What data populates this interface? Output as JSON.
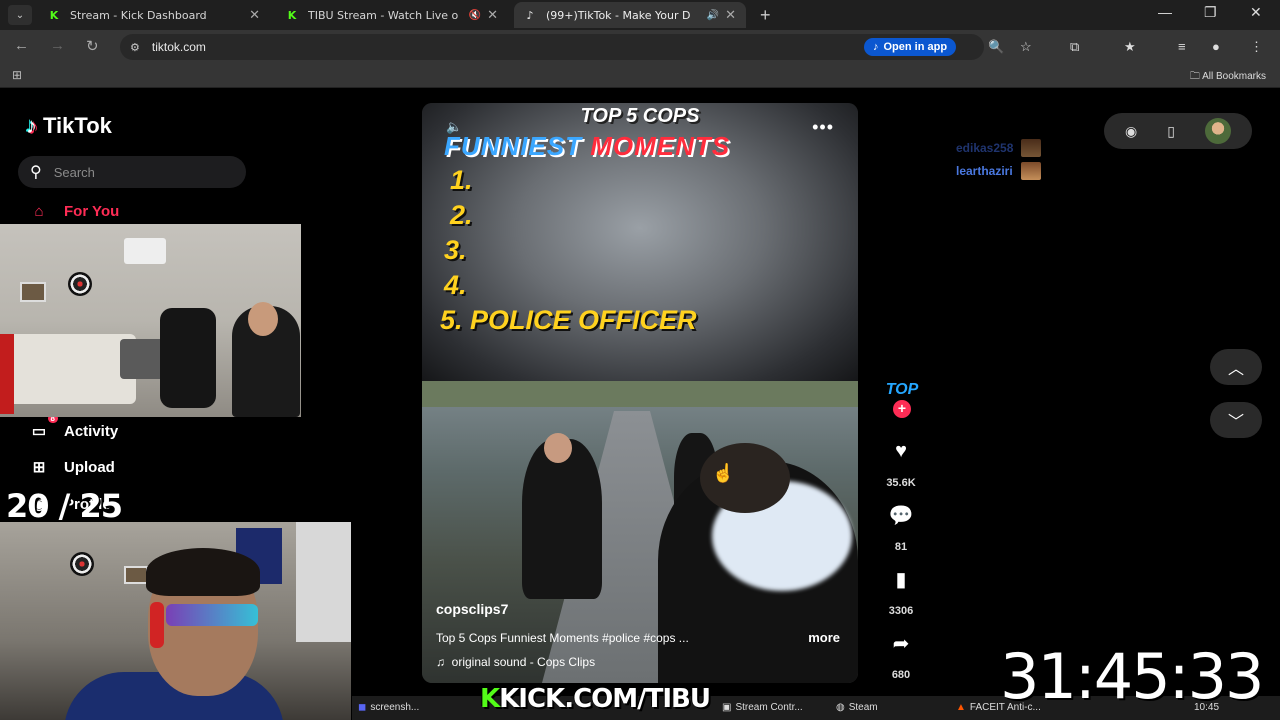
{
  "browser": {
    "tabs": [
      {
        "title": "Stream - Kick Dashboard",
        "favicon": "kick-icon",
        "active": false
      },
      {
        "title": "TIBU Stream - Watch Live o",
        "favicon": "kick-icon",
        "active": false
      },
      {
        "title": "(99+)TikTok - Make Your D",
        "favicon": "tiktok-icon",
        "active": true
      }
    ],
    "url": "tiktok.com",
    "open_in_app": "Open in app",
    "all_bookmarks": "All Bookmarks"
  },
  "tiktok": {
    "brand": "TikTok",
    "search_placeholder": "Search",
    "nav": {
      "for_you": "For You",
      "activity": "Activity",
      "activity_badge": "8",
      "upload": "Upload",
      "profile": "Profile"
    },
    "video": {
      "title_line1": "TOP 5 COPS",
      "title_line2a": "FUNNIEST",
      "title_line2b": "MOMENTS",
      "ranks": [
        "1.",
        "2.",
        "3.",
        "4.",
        "5. POLICE OFFICER"
      ],
      "author": "copsclips7",
      "description": "Top 5 Cops Funniest Moments #police #cops ...",
      "more": "more",
      "sound": "original sound - Cops Clips"
    },
    "actions": {
      "top_label": "TOP",
      "likes": "35.6K",
      "comments": "81",
      "saves": "3306",
      "shares": "680"
    }
  },
  "overlay": {
    "counter": "20 / 25",
    "chat_users": [
      "edikas258",
      "learthaziri"
    ],
    "kick_prefix": "K",
    "kick_url": "KICK.COM/TIBU",
    "timer": "31:45:33"
  },
  "taskbar": {
    "items": [
      "screensh...",
      "Stream Contr...",
      "Steam",
      "FACEIT Anti-c..."
    ],
    "clock": "10:45"
  },
  "colors": {
    "tiktok_red": "#fe2c55",
    "kick_green": "#53fc18",
    "rank_yellow": "#ffd21f"
  }
}
